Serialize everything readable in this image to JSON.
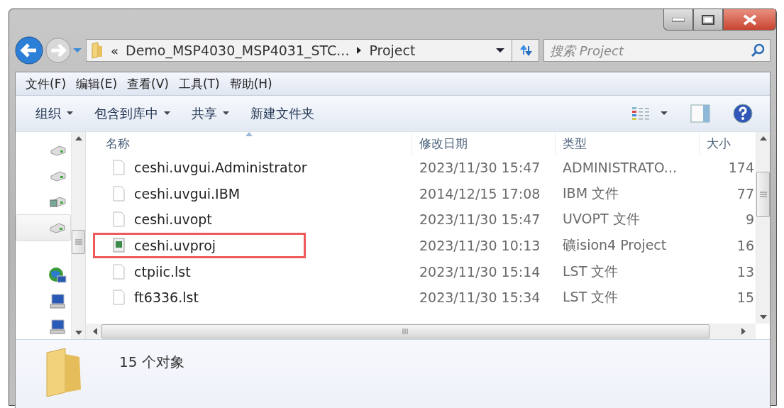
{
  "address_bar": {
    "overflow": "«",
    "path": [
      {
        "label": "Demo_MSP4030_MSP4031_STC..."
      },
      {
        "label": "Project"
      }
    ]
  },
  "search": {
    "placeholder": "搜索 Project"
  },
  "menu_bar": [
    "文件(F)",
    "编辑(E)",
    "查看(V)",
    "工具(T)",
    "帮助(H)"
  ],
  "toolbar": [
    {
      "label": "组织",
      "dropdown": true
    },
    {
      "label": "包含到库中",
      "dropdown": true
    },
    {
      "label": "共享",
      "dropdown": true
    },
    {
      "label": "新建文件夹",
      "dropdown": false
    }
  ],
  "sidebar": {
    "items": [
      {
        "kind": "drive",
        "selected": false
      },
      {
        "kind": "drive",
        "selected": false
      },
      {
        "kind": "media-drive",
        "selected": false
      },
      {
        "kind": "drive",
        "selected": true
      },
      {
        "kind": "network",
        "selected": false
      },
      {
        "kind": "computer",
        "selected": false
      },
      {
        "kind": "computer",
        "selected": false
      }
    ]
  },
  "table": {
    "columns": [
      {
        "label": "名称",
        "sorted": true
      },
      {
        "label": "修改日期",
        "sorted": false
      },
      {
        "label": "类型",
        "sorted": false
      },
      {
        "label": "大小",
        "sorted": false
      }
    ],
    "rows": [
      {
        "kind": "file",
        "name": "ceshi.uvgui.Administrator",
        "date": "2023/11/30 15:47",
        "type": "ADMINISTRATO...",
        "size": "174",
        "annotated": false
      },
      {
        "kind": "file",
        "name": "ceshi.uvgui.IBM",
        "date": "2014/12/15 17:08",
        "type": "IBM 文件",
        "size": "77",
        "annotated": false
      },
      {
        "kind": "file",
        "name": "ceshi.uvopt",
        "date": "2023/11/30 15:47",
        "type": "UVOPT 文件",
        "size": "9",
        "annotated": false
      },
      {
        "kind": "project",
        "name": "ceshi.uvproj",
        "date": "2023/11/30 10:13",
        "type": "礦ision4 Project",
        "size": "16",
        "annotated": true
      },
      {
        "kind": "file",
        "name": "ctpiic.lst",
        "date": "2023/11/30 15:14",
        "type": "LST 文件",
        "size": "13",
        "annotated": false
      },
      {
        "kind": "file",
        "name": "ft6336.lst",
        "date": "2023/11/30 15:34",
        "type": "LST 文件",
        "size": "15",
        "annotated": false
      }
    ]
  },
  "status": {
    "count": "15 个对象"
  }
}
